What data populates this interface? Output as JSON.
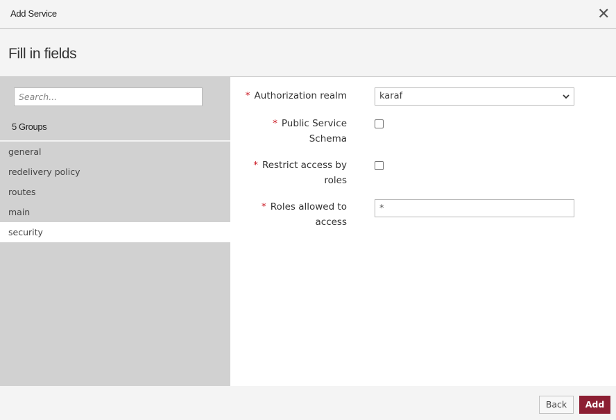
{
  "dialog": {
    "title": "Add Service",
    "close_icon": "close-icon",
    "heading": "Fill in fields"
  },
  "sidebar": {
    "search_placeholder": "Search...",
    "search_value": "",
    "groups_count_label": "5 Groups",
    "groups": [
      {
        "label": "general",
        "active": false
      },
      {
        "label": "redelivery policy",
        "active": false
      },
      {
        "label": "routes",
        "active": false
      },
      {
        "label": "main",
        "active": false
      },
      {
        "label": "security",
        "active": true
      }
    ]
  },
  "form": {
    "required_marker": "*",
    "fields": [
      {
        "label_line1": "Authorization realm",
        "label_line2": "",
        "type": "select",
        "value": "karaf"
      },
      {
        "label_line1": "Public Service",
        "label_line2": "Schema",
        "type": "checkbox",
        "checked": false
      },
      {
        "label_line1": "Restrict access by",
        "label_line2": "roles",
        "type": "checkbox",
        "checked": false
      },
      {
        "label_line1": "Roles allowed to",
        "label_line2": "access",
        "type": "text",
        "value": "*"
      }
    ]
  },
  "footer": {
    "back_label": "Back",
    "add_label": "Add"
  },
  "colors": {
    "accent": "#8c1f33",
    "required": "#c9141e",
    "sidebar_bg": "#d1d1d1"
  }
}
